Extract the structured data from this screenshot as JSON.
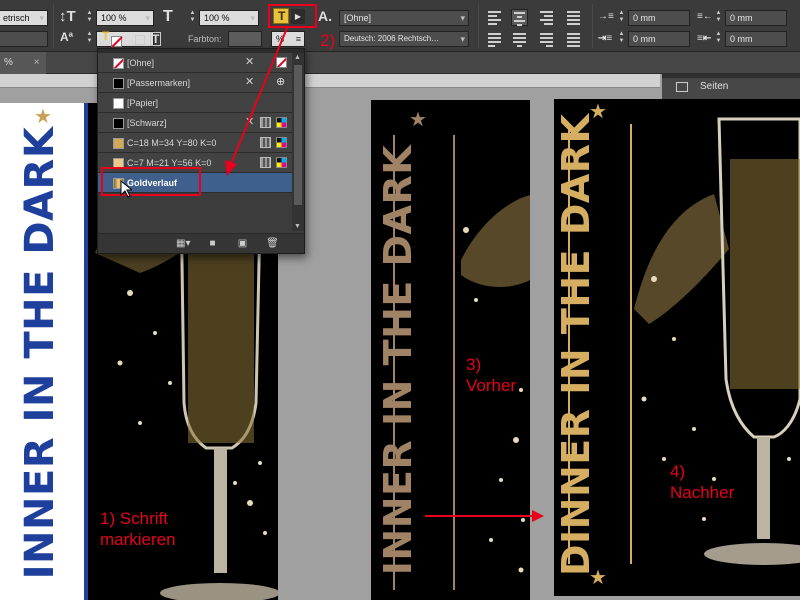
{
  "control_bar": {
    "measure_unit": "etrisch",
    "vertical_scale": "100 %",
    "horizontal_scale": "100 %",
    "character_style": "[Ohne]",
    "language": "Deutsch: 2006 Rechtsch…",
    "tint_label": "Farbton:",
    "tint_unit": "%",
    "indent_left": "0 mm",
    "indent_right": "0 mm",
    "space_before": "0 mm",
    "space_after": "0 mm"
  },
  "tabs": {
    "active_tab": "%",
    "pages_panel": "Seiten"
  },
  "swatches": {
    "items": [
      {
        "name": "[Ohne]",
        "color": "#ffffff",
        "kind": "none"
      },
      {
        "name": "[Passermarken]",
        "color": "#000000",
        "kind": "registration"
      },
      {
        "name": "[Papier]",
        "color": "#ffffff",
        "kind": "paper"
      },
      {
        "name": "[Schwarz]",
        "color": "#000000",
        "kind": "cmyk"
      },
      {
        "name": "C=18 M=34 Y=80 K=0",
        "color": "#d2a956",
        "kind": "cmyk"
      },
      {
        "name": "C=7 M=21 Y=56 K=0",
        "color": "#ebc98a",
        "kind": "cmyk"
      },
      {
        "name": "Goldverlauf",
        "color": "#c9a25a",
        "kind": "gradient",
        "selected": true
      }
    ]
  },
  "documents": {
    "left_title": "INNER IN THE DARK",
    "mid_title": "INNER IN THE DARK",
    "right_title": "DINNER IN THE DARK",
    "blue": "#1f3f9c",
    "gold": "#d6ae62",
    "tan": "#a08264"
  },
  "annotations": {
    "step1_line1": "1) Schrift",
    "step1_line2": "markieren",
    "step2": "2)",
    "step3_line1": "3)",
    "step3_line2": "Vorher",
    "step4_line1": "4)",
    "step4_line2": "Nachher"
  },
  "colors": {
    "annotation_red": "#e8001c",
    "selection_blue": "#3f5f8c",
    "ui_dark": "#3b3b3b"
  }
}
